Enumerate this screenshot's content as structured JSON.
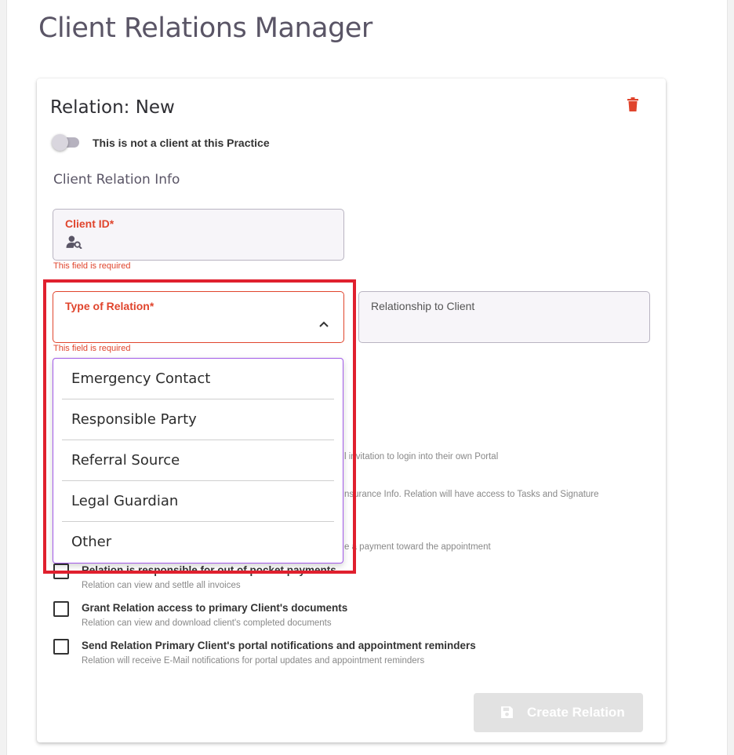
{
  "page": {
    "title": "Client Relations Manager"
  },
  "card": {
    "title": "Relation: New",
    "delete_icon": "trash-icon"
  },
  "toggle": {
    "label": "This is not a client at this Practice",
    "state": "off"
  },
  "section": {
    "title": "Client Relation Info"
  },
  "client_id": {
    "label": "Client ID*",
    "icon": "person-search-icon",
    "error": "This field is required"
  },
  "type_of_relation": {
    "label": "Type of Relation*",
    "icon": "chevron-up-icon",
    "error": "This field is required"
  },
  "relationship_to_client": {
    "label": "Relationship to Client"
  },
  "dropdown": {
    "options": [
      "Emergency Contact",
      "Responsible Party",
      "Referral Source",
      "Legal Guardian",
      "Other"
    ]
  },
  "partial_hints": {
    "h1": "l invitation to login into their own Portal",
    "h2": "nsurance Info. Relation will have access to Tasks and Signature",
    "h3": "e a payment toward the appointment"
  },
  "checkboxes": [
    {
      "label": "Relation is responsible for out of pocket payments",
      "hint": "Relation can view and settle all invoices",
      "checked": false
    },
    {
      "label": "Grant Relation access to primary Client's documents",
      "hint": "Relation can view and download client's completed documents",
      "checked": false
    },
    {
      "label": "Send Relation Primary Client's portal notifications and appointment reminders",
      "hint": "Relation will receive E-Mail notifications for portal updates and appointment reminders",
      "checked": false
    }
  ],
  "create_button": {
    "label": "Create Relation",
    "icon": "save-icon",
    "state": "disabled"
  },
  "colors": {
    "error": "#e0452d",
    "highlight": "#e0202e",
    "dropdown_border": "#a259e8",
    "title": "#5a5566"
  }
}
